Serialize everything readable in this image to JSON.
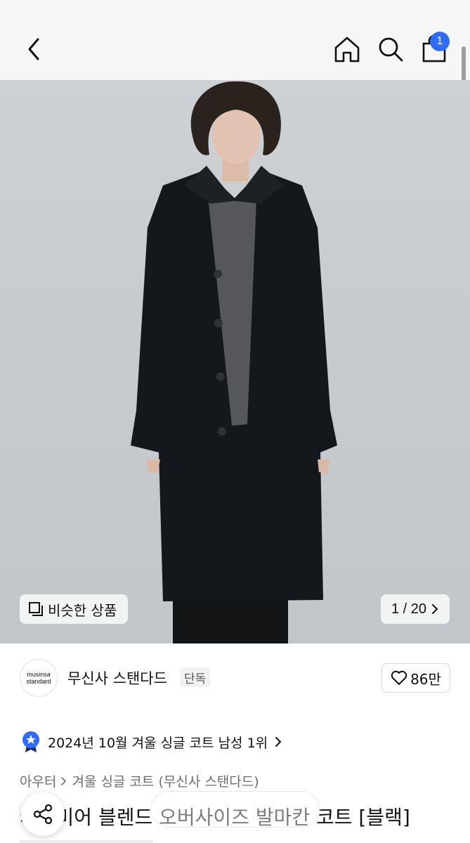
{
  "header": {
    "back_icon": "chevron-left-icon",
    "home_icon": "home-icon",
    "search_icon": "search-icon",
    "cart_icon": "shopping-bag-icon",
    "cart_badge": "1",
    "accent_color": "#2f6bff"
  },
  "gallery": {
    "similar_label": "비슷한 상품",
    "counter": "1 / 20"
  },
  "brand": {
    "logo_line1": "musinsa",
    "logo_line2": "standard",
    "name": "무신사 스탠다드",
    "tag": "단독",
    "like_count": "86만"
  },
  "ranking": {
    "text": "2024년 10월 겨울 싱글 코트 남성 1위"
  },
  "breadcrumb": {
    "items": [
      "아우터",
      "겨울 싱글 코트 (무신사 스탠다드)"
    ]
  },
  "product": {
    "title": "캐시미어 블렌드 오버사이즈 발마칸 코트 [블랙]"
  }
}
